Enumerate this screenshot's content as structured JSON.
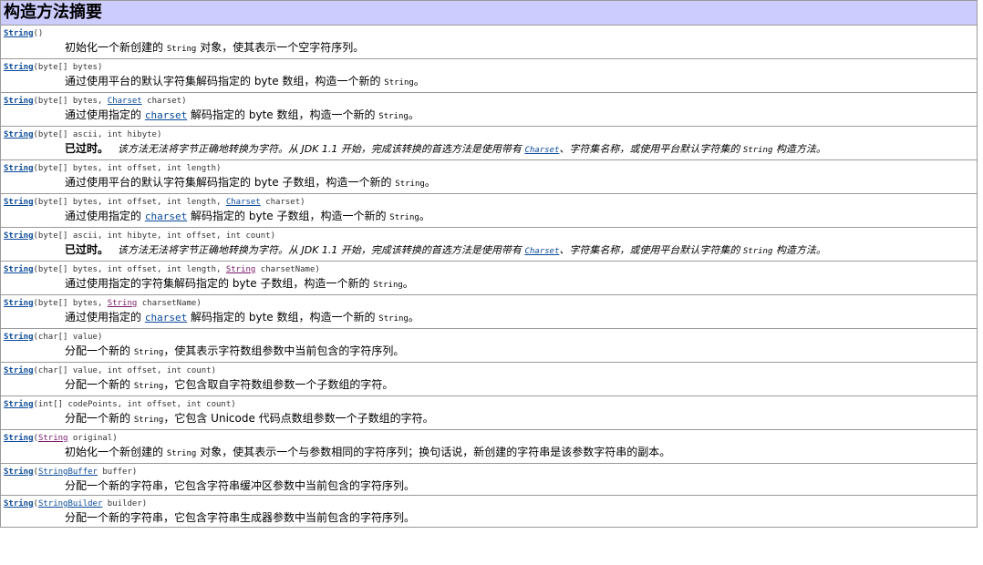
{
  "header": {
    "title": "构造方法摘要"
  },
  "colors": {
    "header_bg": "#ccccff",
    "link": "#0a4a9a",
    "string_link": "#7a1a6a",
    "border": "#9a9a9a"
  },
  "constructors": [
    {
      "name": "String",
      "params": "()",
      "desc_pre": "初始化一个新创建的",
      "desc_code": "String",
      "desc_post": "对象，使其表示一个空字符序列。"
    },
    {
      "name": "String",
      "params": "(byte[] bytes)",
      "desc_pre": "通过使用平台的默认字符集解码指定的 byte 数组，构造一个新的",
      "desc_code": "String",
      "desc_post": "。"
    },
    {
      "name": "String",
      "p1": "(byte[] bytes, ",
      "ptype": "Charset",
      "p2": " charset)",
      "desc_pre": "通过使用指定的",
      "desc_link": "charset",
      "desc_mid": "解码指定的 byte 数组，构造一个新的",
      "desc_code": "String",
      "desc_post": "。"
    },
    {
      "name": "String",
      "params": "(byte[] ascii, int hibyte)",
      "dep_label": "已过时。",
      "dep_pre": "该方法无法将字节正确地转换为字符。从 JDK 1.1 开始，完成该转换的首选方法是使用带有",
      "dep_link": "Charset",
      "dep_mid": "、字符集名称，或使用平台默认字符集的",
      "dep_code": "String",
      "dep_post": "构造方法。"
    },
    {
      "name": "String",
      "params": "(byte[] bytes, int offset, int length)",
      "desc_pre": "通过使用平台的默认字符集解码指定的 byte 子数组，构造一个新的",
      "desc_code": "String",
      "desc_post": "。"
    },
    {
      "name": "String",
      "p1": "(byte[] bytes, int offset, int length, ",
      "ptype": "Charset",
      "p2": " charset)",
      "desc_pre": "通过使用指定的",
      "desc_link": "charset",
      "desc_mid": "解码指定的 byte 子数组，构造一个新的",
      "desc_code": "String",
      "desc_post": "。"
    },
    {
      "name": "String",
      "params": "(byte[] ascii, int hibyte, int offset, int count)",
      "dep_label": "已过时。",
      "dep_pre": "该方法无法将字节正确地转换为字符。从 JDK 1.1 开始，完成该转换的首选方法是使用带有",
      "dep_link": "Charset",
      "dep_mid": "、字符集名称，或使用平台默认字符集的",
      "dep_code": "String",
      "dep_post": "构造方法。"
    },
    {
      "name": "String",
      "p1": "(byte[] bytes, int offset, int length, ",
      "ptype": "String",
      "p2": " charsetName)",
      "desc_pre": "通过使用指定的字符集解码指定的 byte 子数组，构造一个新的",
      "desc_code": "String",
      "desc_post": "。"
    },
    {
      "name": "String",
      "p1": "(byte[] bytes, ",
      "ptype": "String",
      "p2": " charsetName)",
      "desc_pre": "通过使用指定的",
      "desc_link": "charset",
      "desc_mid": "解码指定的 byte 数组，构造一个新的",
      "desc_code": "String",
      "desc_post": "。"
    },
    {
      "name": "String",
      "params": "(char[] value)",
      "desc_pre": "分配一个新的",
      "desc_code": "String",
      "desc_post": "，使其表示字符数组参数中当前包含的字符序列。"
    },
    {
      "name": "String",
      "params": "(char[] value, int offset, int count)",
      "desc_pre": "分配一个新的",
      "desc_code": "String",
      "desc_post": "，它包含取自字符数组参数一个子数组的字符。"
    },
    {
      "name": "String",
      "params": "(int[] codePoints, int offset, int count)",
      "desc_pre": "分配一个新的",
      "desc_code": "String",
      "desc_post": "，它包含 Unicode 代码点数组参数一个子数组的字符。"
    },
    {
      "name": "String",
      "p1": "(",
      "ptype": "String",
      "p2": " original)",
      "desc_pre": "初始化一个新创建的",
      "desc_code": "String",
      "desc_post": "对象，使其表示一个与参数相同的字符序列；换句话说，新创建的字符串是该参数字符串的副本。"
    },
    {
      "name": "String",
      "p1": "(",
      "ptype": "StringBuffer",
      "p2": " buffer)",
      "desc_pre": "分配一个新的字符串，它包含字符串缓冲区参数中当前包含的字符序列。"
    },
    {
      "name": "String",
      "p1": "(",
      "ptype": "StringBuilder",
      "p2": " builder)",
      "desc_pre": "分配一个新的字符串，它包含字符串生成器参数中当前包含的字符序列。"
    }
  ]
}
